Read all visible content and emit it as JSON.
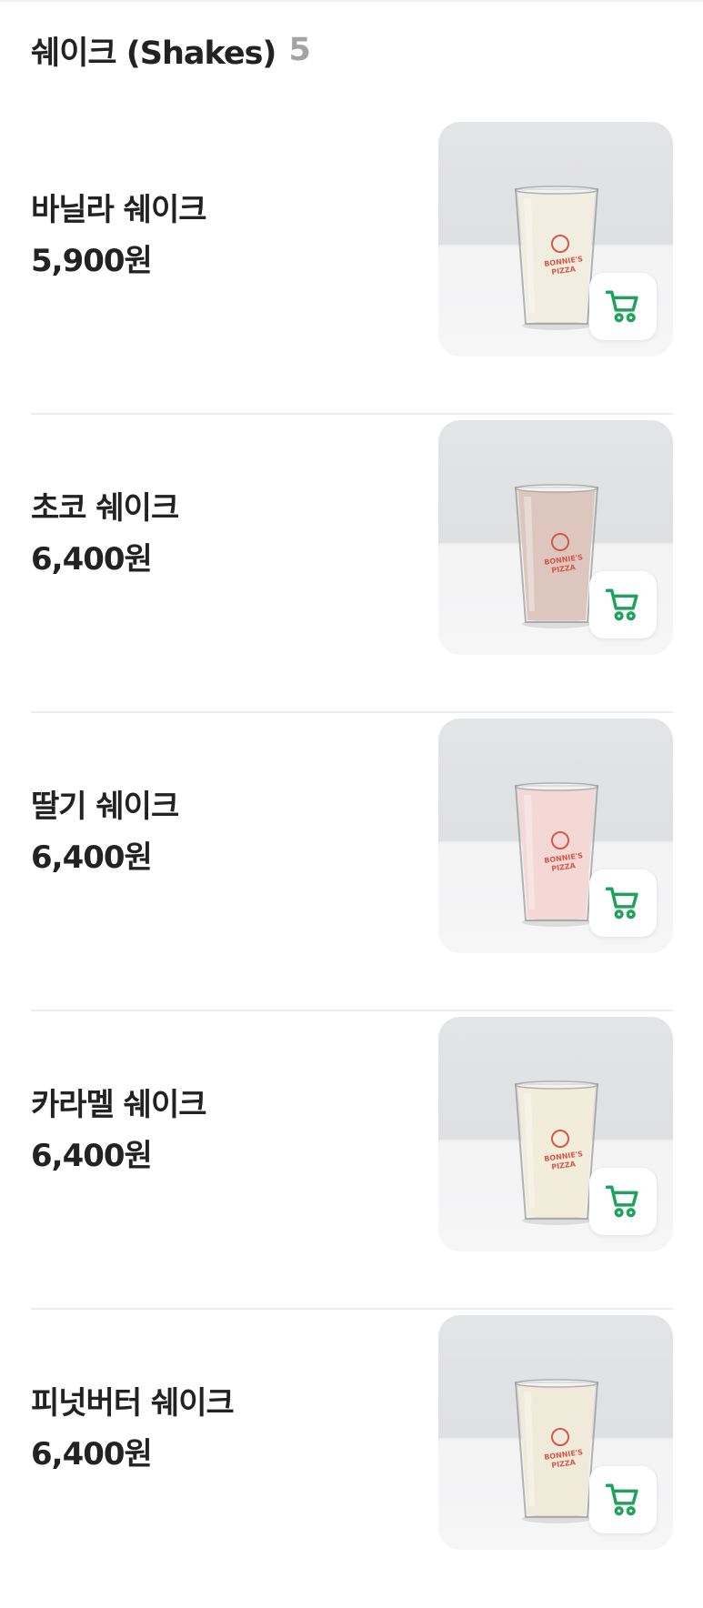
{
  "section": {
    "title": "쉐이크 (Shakes)",
    "count": "5"
  },
  "colors": {
    "accent": "#1fa25a",
    "count": "#a3a3a3",
    "divider": "#eeeeee"
  },
  "items": [
    {
      "name": "바닐라 쉐이크",
      "price": "5,900원",
      "drink_color": "#f1ede0",
      "icon": "shopping-cart-icon"
    },
    {
      "name": "초코 쉐이크",
      "price": "6,400원",
      "drink_color": "#dcc6bd",
      "icon": "shopping-cart-icon"
    },
    {
      "name": "딸기 쉐이크",
      "price": "6,400원",
      "drink_color": "#f3d8d6",
      "icon": "shopping-cart-icon"
    },
    {
      "name": "카라멜 쉐이크",
      "price": "6,400원",
      "drink_color": "#f2ecdb",
      "icon": "shopping-cart-icon"
    },
    {
      "name": "피넛버터 쉐이크",
      "price": "6,400원",
      "drink_color": "#f0eadb",
      "icon": "shopping-cart-icon"
    }
  ],
  "logo_text": "BONNIE'S PIZZA"
}
